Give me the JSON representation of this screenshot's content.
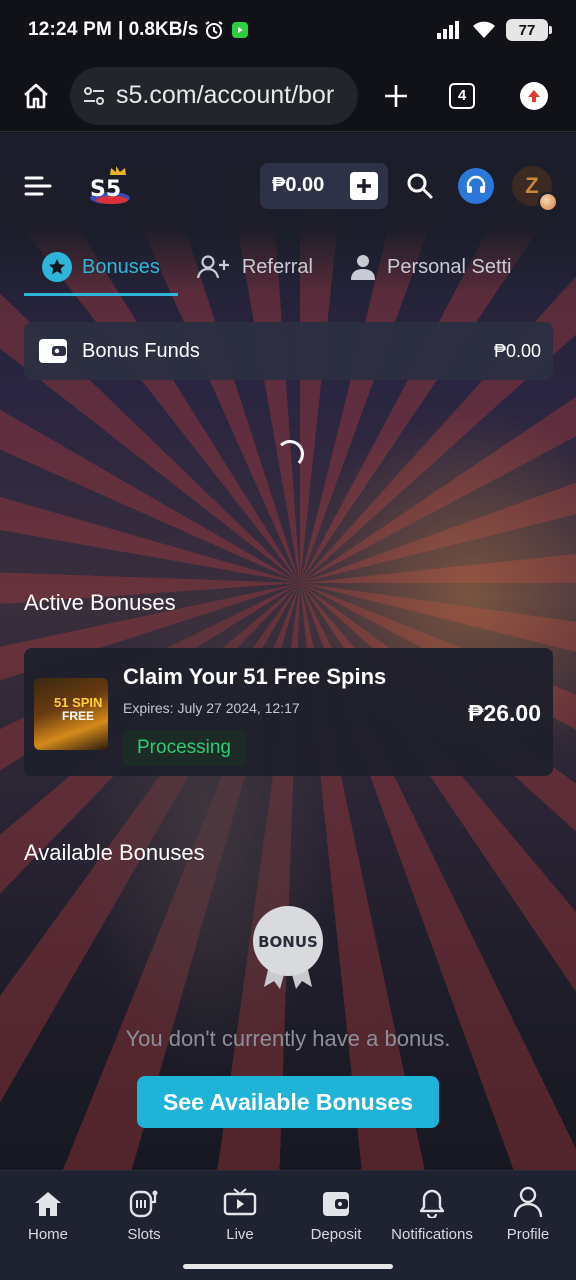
{
  "status_bar": {
    "time": "12:24 PM",
    "net_speed": "| 0.8KB/s",
    "battery": "77"
  },
  "browser": {
    "url": "s5.com/account/bor",
    "tab_count": "4",
    "icons": [
      "home-icon",
      "site-settings-icon",
      "new-tab-icon",
      "tabs-icon",
      "update-icon"
    ]
  },
  "header": {
    "balance": "₱0.00",
    "avatar_initial": "Z",
    "icons": [
      "menu-icon",
      "plus-icon",
      "search-icon",
      "support-icon"
    ]
  },
  "tabs": [
    {
      "label": "Bonuses",
      "active": true,
      "icon": "star-icon"
    },
    {
      "label": "Referral",
      "active": false,
      "icon": "add-user-icon"
    },
    {
      "label": "Personal Setti",
      "active": false,
      "icon": "person-icon"
    }
  ],
  "bonus_funds": {
    "label": "Bonus Funds",
    "value": "₱0.00"
  },
  "active_bonuses": {
    "title": "Active Bonuses",
    "items": [
      {
        "title": "Claim Your 51 Free Spins",
        "expires": "Expires: July 27 2024, 12:17",
        "status": "Processing",
        "amount": "₱26.00",
        "thumb_line1": "51 SPIN",
        "thumb_line2": "FREE"
      }
    ]
  },
  "available_bonuses": {
    "title": "Available Bonuses",
    "badge_text": "BONUS",
    "empty_message": "You don't currently have a bonus.",
    "cta_label": "See Available Bonuses"
  },
  "bottom_nav": [
    {
      "label": "Home",
      "icon": "home-icon"
    },
    {
      "label": "Slots",
      "icon": "slot-machine-icon"
    },
    {
      "label": "Live",
      "icon": "tv-icon"
    },
    {
      "label": "Deposit",
      "icon": "wallet-icon"
    },
    {
      "label": "Notifications",
      "icon": "bell-icon"
    },
    {
      "label": "Profile",
      "icon": "profile-icon"
    }
  ],
  "colors": {
    "accent": "#2fb5d9",
    "cta": "#1fb3d8",
    "status_processing": "#2ecc71",
    "nav_bg": "#1f2230"
  }
}
